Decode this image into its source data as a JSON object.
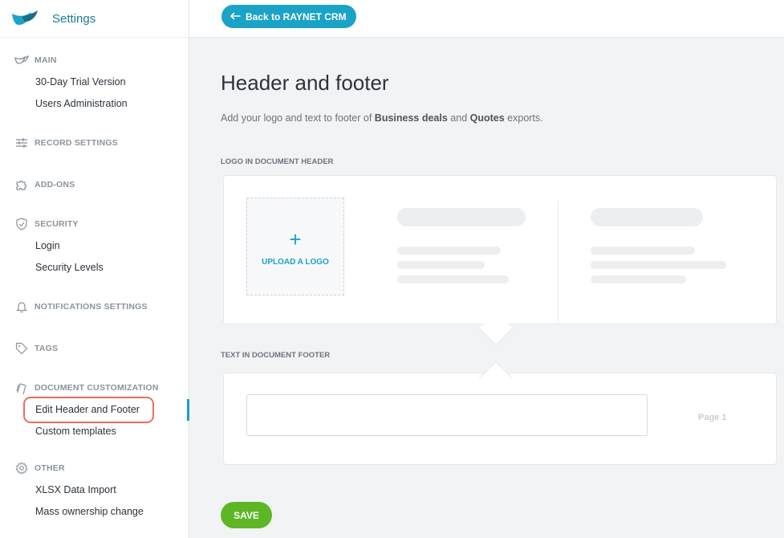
{
  "app": {
    "title": "Settings"
  },
  "sidebar": {
    "sections": [
      {
        "label": "MAIN",
        "icon": "raynet-logo-icon",
        "items": [
          "30-Day Trial Version",
          "Users Administration"
        ]
      },
      {
        "label": "RECORD SETTINGS",
        "icon": "sliders-icon",
        "items": []
      },
      {
        "label": "ADD-ONS",
        "icon": "puzzle-icon",
        "items": []
      },
      {
        "label": "SECURITY",
        "icon": "shield-check-icon",
        "items": [
          "Login",
          "Security Levels"
        ]
      },
      {
        "label": "NOTIFICATIONS SETTINGS",
        "icon": "bell-icon",
        "items": []
      },
      {
        "label": "TAGS",
        "icon": "tag-icon",
        "items": []
      },
      {
        "label": "DOCUMENT CUSTOMIZATION",
        "icon": "document-icon",
        "items": [
          "Edit Header and Footer",
          "Custom templates"
        ]
      },
      {
        "label": "OTHER",
        "icon": "gear-icon",
        "items": [
          "XLSX Data Import",
          "Mass ownership change"
        ]
      }
    ],
    "active_item": "Edit Header and Footer"
  },
  "topbar": {
    "back_label": "Back to RAYNET CRM"
  },
  "main": {
    "title": "Header and footer",
    "description": {
      "part1": "Add your logo and text to footer of ",
      "bold1": "Business deals",
      "part2": " and ",
      "bold2": "Quotes",
      "part3": " exports."
    },
    "header_section_label": "LOGO IN DOCUMENT HEADER",
    "upload_label": "UPLOAD A LOGO",
    "footer_section_label": "TEXT IN DOCUMENT FOOTER",
    "footer_text_value": "",
    "page_label": "Page 1",
    "save_label": "SAVE"
  },
  "colors": {
    "accent": "#1aa3c6",
    "brand_text": "#1c7a93",
    "save": "#5eb625",
    "highlight": "#e6705c"
  }
}
